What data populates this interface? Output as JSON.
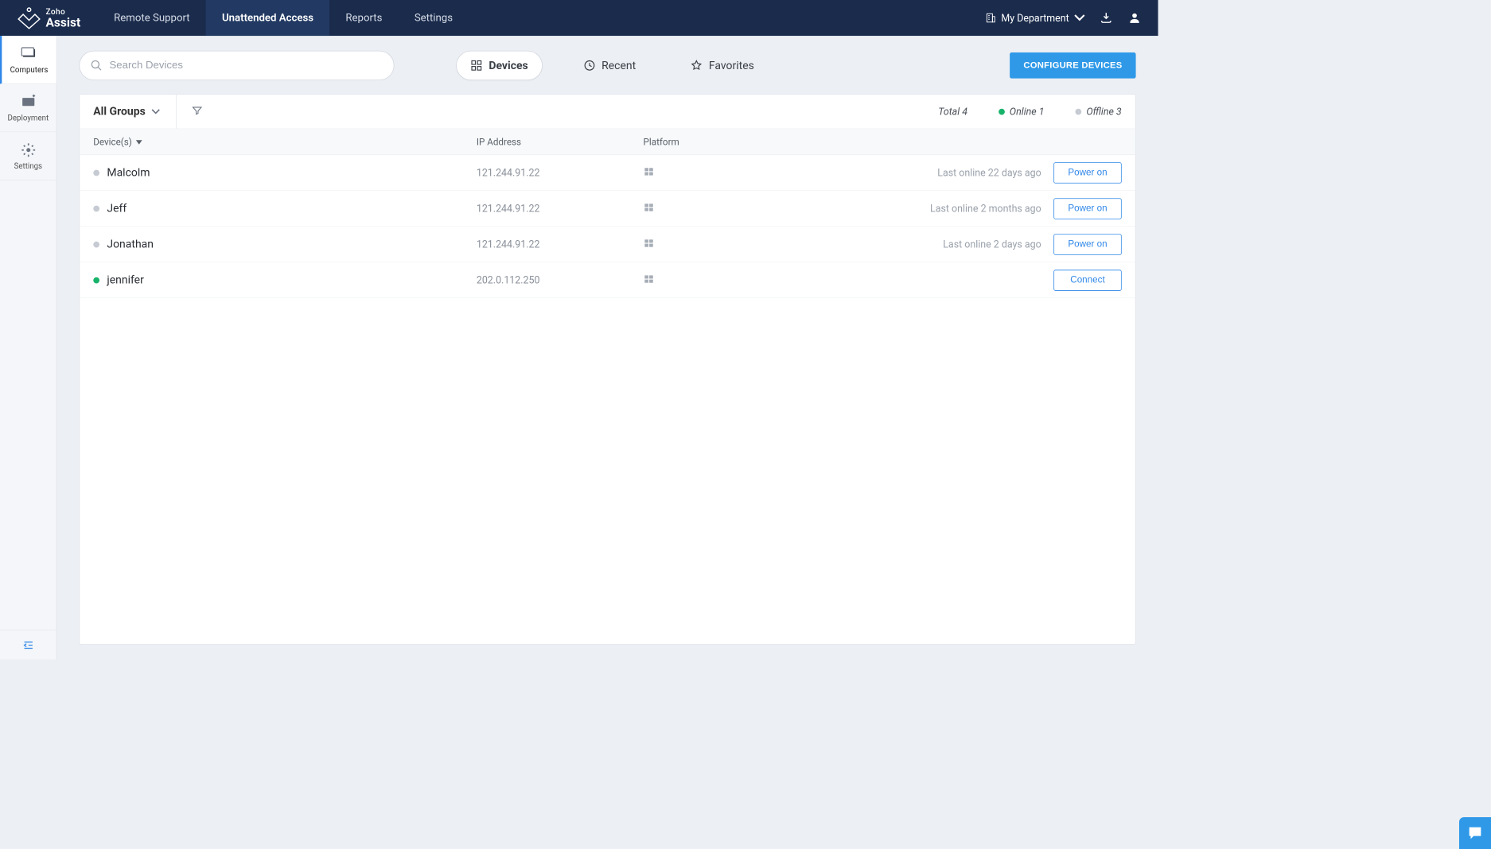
{
  "brand": {
    "top": "Zoho",
    "bottom": "Assist"
  },
  "nav": {
    "links": [
      "Remote Support",
      "Unattended Access",
      "Reports",
      "Settings"
    ],
    "active_index": 1,
    "department": "My Department"
  },
  "sidebar": {
    "items": [
      {
        "label": "Computers"
      },
      {
        "label": "Deployment"
      },
      {
        "label": "Settings"
      }
    ],
    "active_index": 0
  },
  "search": {
    "placeholder": "Search Devices"
  },
  "tabs": {
    "items": [
      "Devices",
      "Recent",
      "Favorites"
    ],
    "active_index": 0
  },
  "configure_label": "CONFIGURE DEVICES",
  "groups_label": "All Groups",
  "stats": {
    "total_label": "Total 4",
    "online_label": "Online 1",
    "offline_label": "Offline 3"
  },
  "columns": {
    "device": "Device(s)",
    "ip": "IP Address",
    "platform": "Platform"
  },
  "devices": [
    {
      "name": "Malcolm",
      "ip": "121.244.91.22",
      "online": false,
      "last": "Last online 22 days ago",
      "action": "Power on"
    },
    {
      "name": "Jeff",
      "ip": "121.244.91.22",
      "online": false,
      "last": "Last online 2 months ago",
      "action": "Power on"
    },
    {
      "name": "Jonathan",
      "ip": "121.244.91.22",
      "online": false,
      "last": "Last online 2 days ago",
      "action": "Power on"
    },
    {
      "name": "jennifer",
      "ip": "202.0.112.250",
      "online": true,
      "last": "",
      "action": "Connect"
    }
  ]
}
